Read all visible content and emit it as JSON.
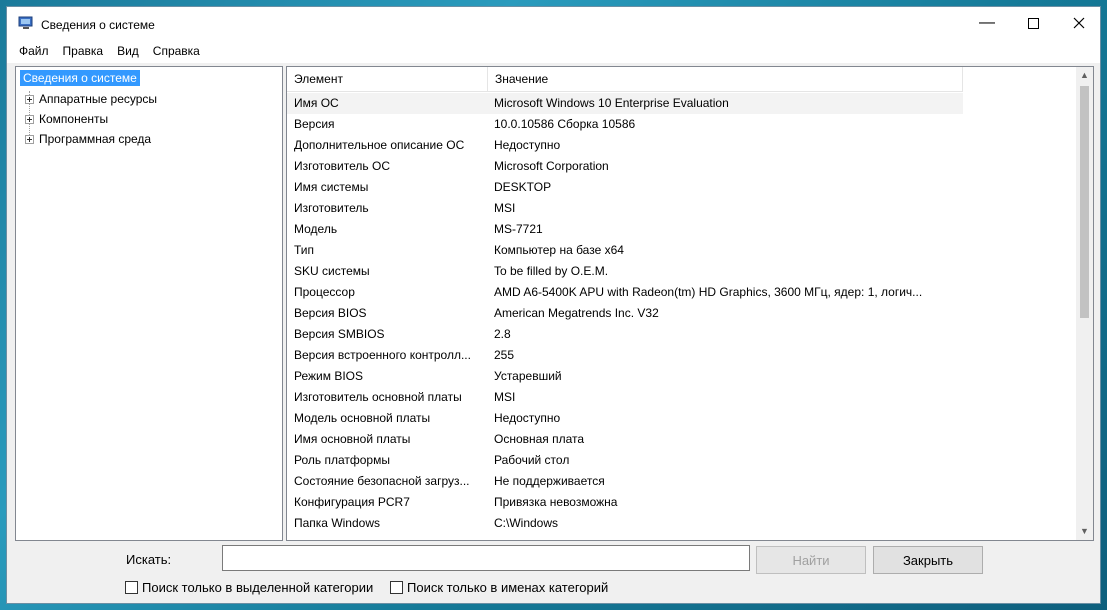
{
  "window": {
    "title": "Сведения о системе",
    "icons": {
      "app": "system-info-icon",
      "minimize": "minimize-icon",
      "maximize": "maximize-icon",
      "close": "close-icon"
    }
  },
  "menu": [
    "Файл",
    "Правка",
    "Вид",
    "Справка"
  ],
  "tree": {
    "root": "Сведения о системе",
    "children": [
      "Аппаратные ресурсы",
      "Компоненты",
      "Программная среда"
    ]
  },
  "table": {
    "columns": [
      "Элемент",
      "Значение"
    ],
    "rows": [
      {
        "name": "Имя ОС",
        "value": "Microsoft Windows 10 Enterprise Evaluation"
      },
      {
        "name": "Версия",
        "value": "10.0.10586 Сборка 10586"
      },
      {
        "name": "Дополнительное описание ОС",
        "value": "Недоступно"
      },
      {
        "name": "Изготовитель ОС",
        "value": "Microsoft Corporation"
      },
      {
        "name": "Имя системы",
        "value": "DESKTOP"
      },
      {
        "name": "Изготовитель",
        "value": "MSI"
      },
      {
        "name": "Модель",
        "value": "MS-7721"
      },
      {
        "name": "Тип",
        "value": "Компьютер на базе x64"
      },
      {
        "name": "SKU системы",
        "value": "To be filled by O.E.M."
      },
      {
        "name": "Процессор",
        "value": "AMD A6-5400K APU with Radeon(tm) HD Graphics, 3600 МГц, ядер: 1, логич..."
      },
      {
        "name": "Версия BIOS",
        "value": "American Megatrends Inc. V32"
      },
      {
        "name": "Версия SMBIOS",
        "value": "2.8"
      },
      {
        "name": "Версия встроенного контролл...",
        "value": "255"
      },
      {
        "name": "Режим BIOS",
        "value": "Устаревший"
      },
      {
        "name": "Изготовитель основной платы",
        "value": "MSI"
      },
      {
        "name": "Модель основной платы",
        "value": "Недоступно"
      },
      {
        "name": "Имя основной платы",
        "value": "Основная плата"
      },
      {
        "name": "Роль платформы",
        "value": "Рабочий стол"
      },
      {
        "name": "Состояние безопасной загруз...",
        "value": "Не поддерживается"
      },
      {
        "name": "Конфигурация PCR7",
        "value": "Привязка невозможна"
      },
      {
        "name": "Папка Windows",
        "value": "C:\\Windows"
      }
    ]
  },
  "search": {
    "label": "Искать:",
    "value": "",
    "find_button": "Найти",
    "close_button": "Закрыть",
    "option_selected_category": "Поиск только в выделенной категории",
    "option_category_names": "Поиск только в именах категорий"
  }
}
